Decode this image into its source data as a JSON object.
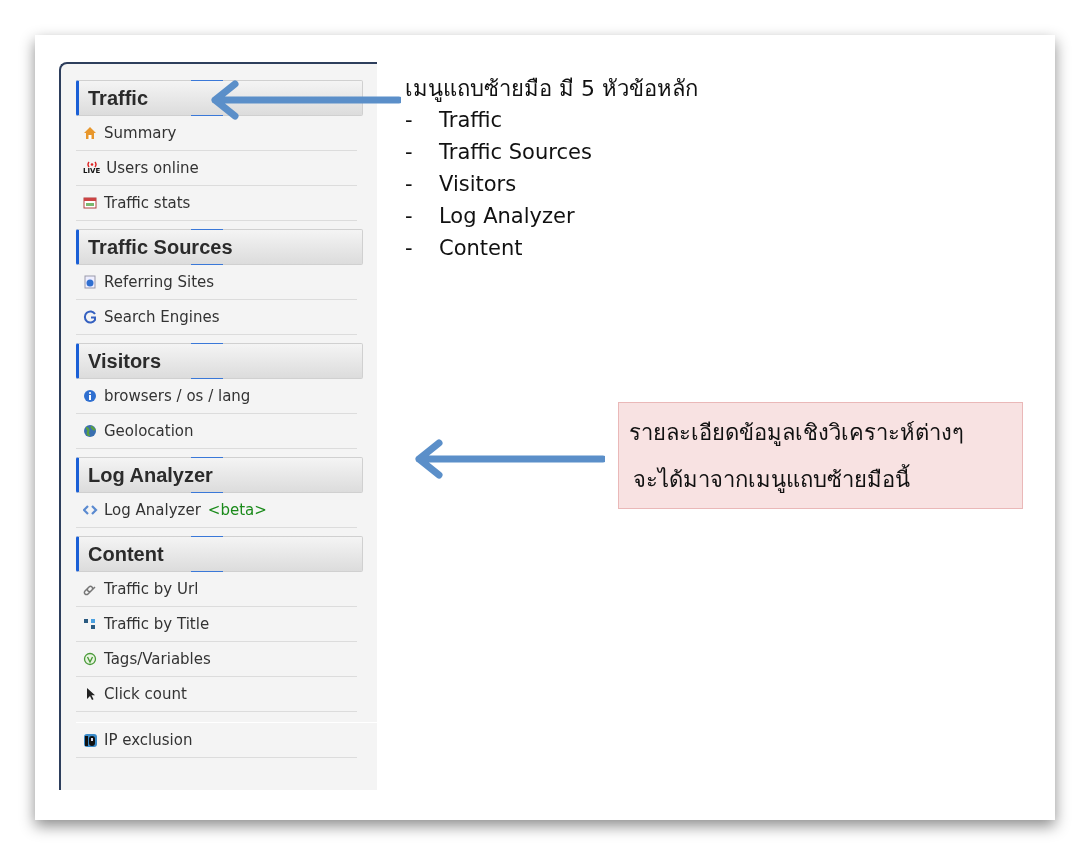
{
  "sidebar": {
    "groups": [
      {
        "title": "Traffic",
        "items": [
          {
            "label": "Summary"
          },
          {
            "label": "Users online",
            "icon_text": "LIVE"
          },
          {
            "label": "Traffic stats"
          }
        ]
      },
      {
        "title": "Traffic Sources",
        "items": [
          {
            "label": "Referring Sites"
          },
          {
            "label": "Search Engines"
          }
        ]
      },
      {
        "title": "Visitors",
        "items": [
          {
            "label": "browsers / os / lang"
          },
          {
            "label": "Geolocation"
          }
        ]
      },
      {
        "title": "Log Analyzer",
        "items": [
          {
            "label": "Log Analyzer",
            "tag": "<beta>"
          }
        ]
      },
      {
        "title": "Content",
        "items": [
          {
            "label": "Traffic by Url"
          },
          {
            "label": "Traffic by Title"
          },
          {
            "label": "Tags/Variables"
          },
          {
            "label": "Click count"
          }
        ]
      },
      {
        "items": [
          {
            "label": "IP exclusion"
          }
        ]
      }
    ]
  },
  "notes": {
    "title": "เมนูแถบซ้ายมือ มี 5 หัวข้อหลัก",
    "bullets": [
      {
        "dash": "-",
        "text": "Traffic"
      },
      {
        "dash": "-",
        "text": "Traffic Sources"
      },
      {
        "dash": "-",
        "text": "Visitors"
      },
      {
        "dash": "-",
        "text": "Log Analyzer"
      },
      {
        "dash": "-",
        "text": "Content"
      }
    ]
  },
  "callout": {
    "lines": [
      "รายละเอียดข้อมูลเชิงวิเคราะห์ต่างๆ",
      "จะได้มาจากเมนูแถบซ้ายมือนี้"
    ]
  }
}
